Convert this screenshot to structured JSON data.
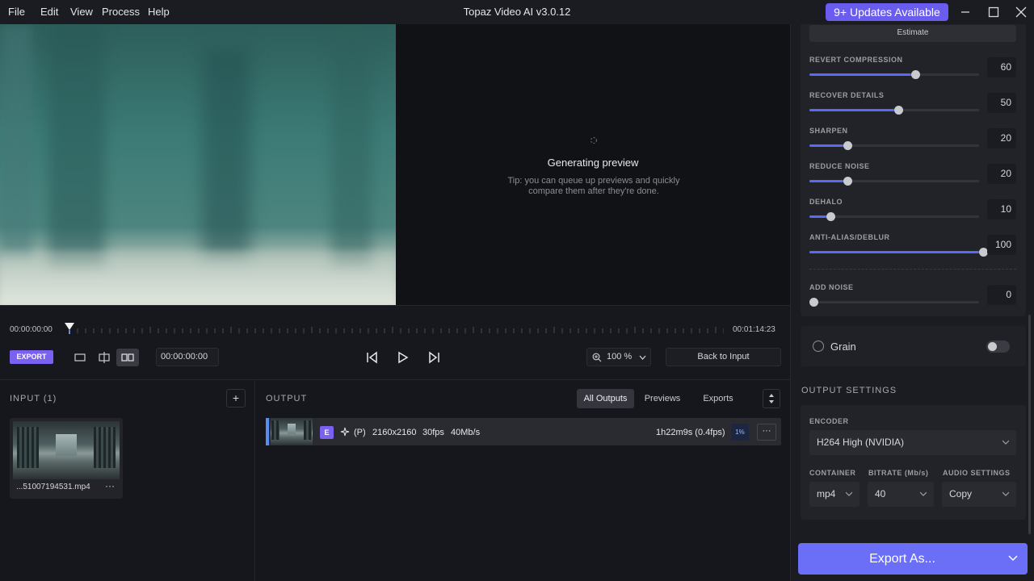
{
  "titlebar": {
    "menu": [
      "File",
      "Edit",
      "View",
      "Process",
      "Help"
    ],
    "title": "Topaz Video AI  v3.0.12",
    "updates_label": "9+ Updates Available"
  },
  "preview": {
    "generating_title": "Generating preview",
    "tip_line1": "Tip: you can queue up previews and quickly",
    "tip_line2": "compare them after they're done."
  },
  "timeline": {
    "start_time": "00:00:00:00",
    "end_time": "00:01:14:23",
    "export_label": "EXPORT",
    "current_time": "00:00:00:00",
    "zoom_value": "100 %",
    "back_to_input_label": "Back to Input"
  },
  "input_panel": {
    "title": "INPUT (1)",
    "add_label": "+",
    "file_name": "...51007194531.mp4",
    "more_label": "···"
  },
  "output_panel": {
    "title": "OUTPUT",
    "tabs": [
      "All Outputs",
      "Previews",
      "Exports"
    ],
    "active_tab": "All Outputs",
    "row": {
      "badge": "E",
      "preset": "(P)",
      "resolution": "2160x2160",
      "fps": "30fps",
      "bitrate": "40Mb/s",
      "eta": "1h22m9s (0.4fps)",
      "progress": "1%",
      "more_label": "···"
    }
  },
  "enhancement": {
    "estimate_label": "Estimate",
    "sliders": [
      {
        "label": "REVERT COMPRESSION",
        "value": 60
      },
      {
        "label": "RECOVER DETAILS",
        "value": 50
      },
      {
        "label": "SHARPEN",
        "value": 20
      },
      {
        "label": "REDUCE NOISE",
        "value": 20
      },
      {
        "label": "DEHALO",
        "value": 10
      },
      {
        "label": "ANTI-ALIAS/DEBLUR",
        "value": 100
      },
      {
        "label": "ADD NOISE",
        "value": 0
      }
    ]
  },
  "grain": {
    "label": "Grain",
    "enabled": false
  },
  "output_settings": {
    "title": "OUTPUT SETTINGS",
    "encoder_label": "ENCODER",
    "encoder_value": "H264 High (NVIDIA)",
    "container_label": "CONTAINER",
    "container_value": "mp4",
    "bitrate_label": "BITRATE (Mb/s)",
    "bitrate_value": "40",
    "audio_label": "AUDIO SETTINGS",
    "audio_value": "Copy"
  },
  "export_as_label": "Export As...",
  "colors": {
    "accent": "#6b6ef7",
    "badge": "#7b61f0",
    "slider_fill": "#5b6af5"
  }
}
